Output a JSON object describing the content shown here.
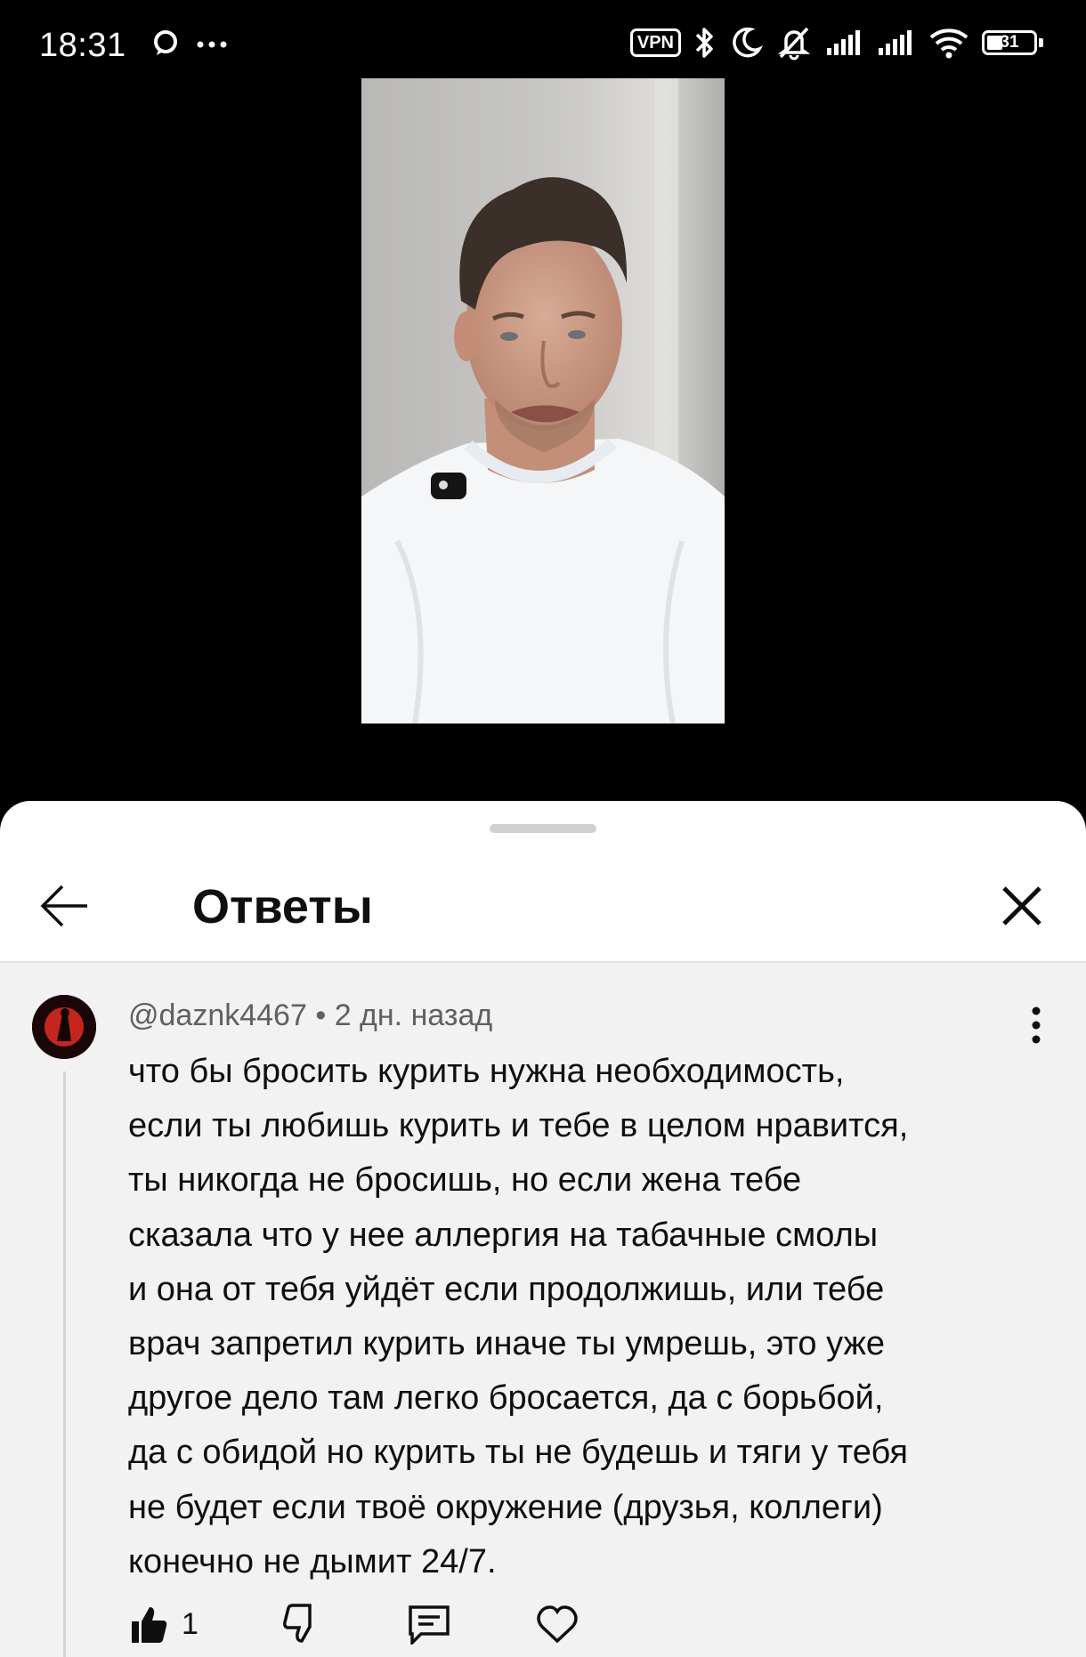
{
  "status_bar": {
    "time": "18:31",
    "vpn_label": "VPN",
    "battery": "31"
  },
  "sheet": {
    "title": "Ответы"
  },
  "comment": {
    "author": "@daznk4467",
    "separator": "•",
    "age": "2 дн. назад",
    "text": "что бы бросить курить нужна необходимость,\nесли ты любишь курить и тебе в целом нравится,\nты никогда не бросишь, но если жена тебе\nсказала что у нее аллергия на табачные смолы\nи она от тебя уйдёт если продолжишь, или тебе\nврач запретил курить иначе ты умрешь, это уже\nдругое дело там легко бросается, да с борьбой,\nда с обидой но курить ты не будешь и тяги у тебя\nне будет если твоё окружение (друзья, коллеги)\nконечно не дымит 24/7.",
    "likes": "1"
  },
  "icons": [
    "message-icon",
    "more-icon",
    "vpn-icon",
    "bluetooth-icon",
    "moon-icon",
    "mute-icon",
    "signal-icon",
    "wifi-icon",
    "battery-icon",
    "back-arrow-icon",
    "close-icon",
    "more-vert-icon",
    "like-icon",
    "dislike-icon",
    "reply-icon",
    "heart-icon"
  ]
}
